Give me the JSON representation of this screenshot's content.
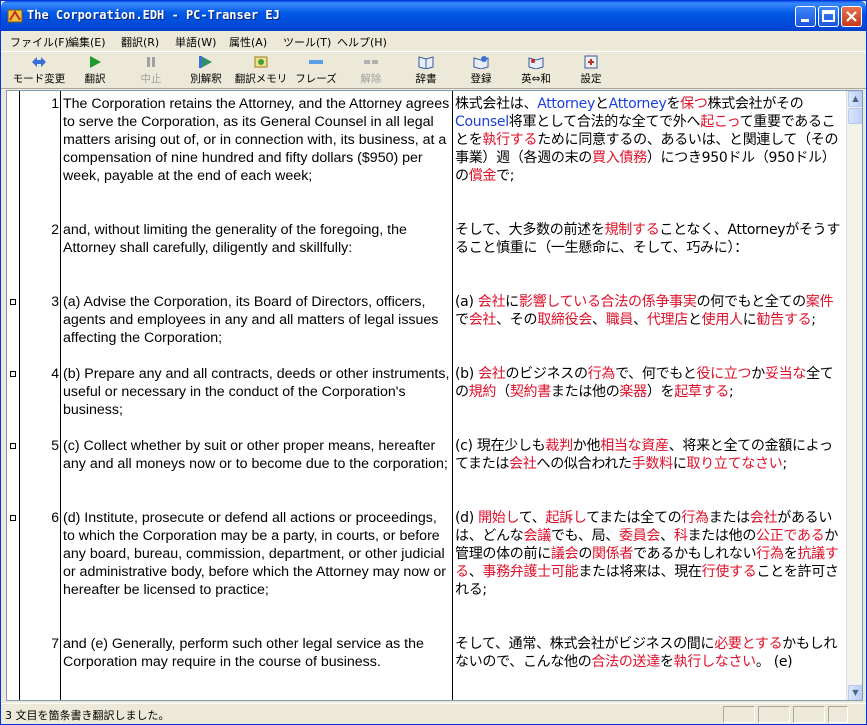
{
  "window": {
    "title": "The Corporation.EDH - PC-Transer EJ"
  },
  "menu": [
    "ファイル(F)",
    "編集(E)",
    "翻訳(R)",
    "単語(W)",
    "属性(A)",
    "ツール(T)",
    "ヘルプ(H)"
  ],
  "toolbar": [
    {
      "label": "モード変更",
      "icon": "mode-change-icon",
      "enabled": true
    },
    {
      "label": "翻訳",
      "icon": "play-icon",
      "enabled": true
    },
    {
      "label": "中止",
      "icon": "pause-icon",
      "enabled": false
    },
    {
      "label": "別解釈",
      "icon": "alternate-play-icon",
      "enabled": true
    },
    {
      "label": "翻訳メモリ",
      "icon": "translation-memory-icon",
      "enabled": true
    },
    {
      "label": "フレーズ",
      "icon": "phrase-icon",
      "enabled": true
    },
    {
      "label": "解除",
      "icon": "release-icon",
      "enabled": false
    },
    {
      "label": "辞書",
      "icon": "dictionary-icon",
      "enabled": true
    },
    {
      "label": "登録",
      "icon": "register-icon",
      "enabled": true
    },
    {
      "label": "英⇔和",
      "icon": "swap-direction-icon",
      "enabled": true
    },
    {
      "label": "設定",
      "icon": "settings-icon",
      "enabled": true
    }
  ],
  "colors": {
    "highlight_red": "#e0102a",
    "highlight_blue": "#1a3ee0",
    "titlebar_blue": "#0058e6"
  },
  "sentences": [
    {
      "num": "1",
      "marker": false,
      "en": "The Corporation retains the Attorney, and the Attorney agrees to serve the Corporation, as its General Counsel in all legal matters arising out of, or in connection with, its business, at a compensation of nine hundred and fifty dollars ($950) per week, payable at the end of each week;",
      "ja": [
        [
          "株式会社は、",
          ""
        ],
        [
          "Attorney",
          "b"
        ],
        [
          "と",
          ""
        ],
        [
          "Attorney",
          "b"
        ],
        [
          "を",
          ""
        ],
        [
          "保つ",
          "r"
        ],
        [
          "株式会社がそ",
          ""
        ],
        [
          "の",
          ""
        ],
        [
          "Counsel",
          "b"
        ],
        [
          "将軍として合法的な全てで外へ",
          ""
        ],
        [
          "起こっ",
          "r"
        ],
        [
          "て重要であることを",
          ""
        ],
        [
          "執行する",
          "r"
        ],
        [
          "ために同意するの、あるいは、と関連して（その事業）週（各週の末の",
          ""
        ],
        [
          "買入債務",
          "r"
        ],
        [
          "）につき950ドル（950ドル）の",
          ""
        ],
        [
          "償金",
          "r"
        ],
        [
          "で;",
          ""
        ]
      ]
    },
    {
      "num": "2",
      "marker": false,
      "en": "and, without limiting the generality of the foregoing, the Attorney shall carefully, diligently and skillfully:",
      "ja": [
        [
          "そして、大多数の前述を",
          ""
        ],
        [
          "規制する",
          "r"
        ],
        [
          "ことなく、Attorneyがそうすること慎重に（一生懸命に、そして、巧みに）：",
          ""
        ]
      ]
    },
    {
      "num": "3",
      "marker": true,
      "en": "(a) Advise the Corporation, its Board of Directors, officers, agents and employees in any and all matters of legal issues affecting the Corporation;",
      "ja": [
        [
          "(a) ",
          ""
        ],
        [
          "会社",
          "r"
        ],
        [
          "に",
          ""
        ],
        [
          "影響している合法の係争事実",
          "r"
        ],
        [
          "の何でもと全ての",
          ""
        ],
        [
          "案件",
          "r"
        ],
        [
          "で",
          ""
        ],
        [
          "会社",
          "r"
        ],
        [
          "、その",
          ""
        ],
        [
          "取締役会",
          "r"
        ],
        [
          "、",
          ""
        ],
        [
          "職員",
          "r"
        ],
        [
          "、",
          ""
        ],
        [
          "代理店",
          "r"
        ],
        [
          "と",
          ""
        ],
        [
          "使用人",
          "r"
        ],
        [
          "に",
          ""
        ],
        [
          "勧告する",
          "r"
        ],
        [
          ";",
          ""
        ]
      ]
    },
    {
      "num": "4",
      "marker": true,
      "en": "(b) Prepare any and all contracts, deeds or other instruments, useful or necessary in the conduct of the Corporation's business;",
      "ja": [
        [
          "(b) ",
          ""
        ],
        [
          "会社",
          "r"
        ],
        [
          "のビジネスの",
          ""
        ],
        [
          "行為",
          "r"
        ],
        [
          "で、何でもと",
          ""
        ],
        [
          "役に立つ",
          "r"
        ],
        [
          "か",
          ""
        ],
        [
          "妥当な",
          "r"
        ],
        [
          "全ての",
          ""
        ],
        [
          "規約",
          "r"
        ],
        [
          "（",
          ""
        ],
        [
          "契約書",
          "r"
        ],
        [
          "または他の",
          ""
        ],
        [
          "楽器",
          "r"
        ],
        [
          "）を",
          ""
        ],
        [
          "起草する",
          "r"
        ],
        [
          ";",
          ""
        ]
      ]
    },
    {
      "num": "5",
      "marker": true,
      "en": "(c) Collect whether by suit or other proper means, hereafter any and all moneys now or to become due to the corporation;",
      "ja": [
        [
          "(c) 現在少しも",
          ""
        ],
        [
          "裁判",
          "r"
        ],
        [
          "か他",
          ""
        ],
        [
          "相当な資産",
          "r"
        ],
        [
          "、将来と全ての金額によってまたは",
          ""
        ],
        [
          "会社",
          "r"
        ],
        [
          "への似合われた",
          ""
        ],
        [
          "手数料",
          "r"
        ],
        [
          "に",
          ""
        ],
        [
          "取り立てなさい",
          "r"
        ],
        [
          ";",
          ""
        ]
      ]
    },
    {
      "num": "6",
      "marker": true,
      "en": "(d) Institute, prosecute or defend all actions or proceedings, to which the Corporation may be a party, in courts, or before any board, bureau, commission, department, or other judicial or administrative body, before which the Attorney may now or hereafter be licensed to practice;",
      "ja": [
        [
          "(d) ",
          ""
        ],
        [
          "開始し",
          "r"
        ],
        [
          "て、",
          ""
        ],
        [
          "起訴し",
          "r"
        ],
        [
          "てまたは全ての",
          ""
        ],
        [
          "行為",
          "r"
        ],
        [
          "または",
          ""
        ],
        [
          "会社",
          "r"
        ],
        [
          "があるいは、どんな",
          ""
        ],
        [
          "会議",
          "r"
        ],
        [
          "でも、局、",
          ""
        ],
        [
          "委員会",
          "r"
        ],
        [
          "、",
          ""
        ],
        [
          "科",
          "r"
        ],
        [
          "または他の",
          ""
        ],
        [
          "公正である",
          "r"
        ],
        [
          "か管理の体の前に",
          ""
        ],
        [
          "議会",
          "r"
        ],
        [
          "の",
          ""
        ],
        [
          "関係者",
          "r"
        ],
        [
          "であるかもしれない",
          ""
        ],
        [
          "行為",
          "r"
        ],
        [
          "を",
          ""
        ],
        [
          "抗議する",
          "r"
        ],
        [
          "、",
          ""
        ],
        [
          "事務弁護士可能",
          "r"
        ],
        [
          "または将来は、現在",
          ""
        ],
        [
          "行使する",
          "r"
        ],
        [
          "ことを許可される;",
          ""
        ]
      ]
    },
    {
      "num": "7",
      "marker": false,
      "en": "and (e) Generally, perform such other legal service as the Corporation may require in the course of business.",
      "ja": [
        [
          "そして、通常、株式会社がビジネスの間に",
          ""
        ],
        [
          "必要とする",
          "r"
        ],
        [
          "かもしれないので、こんな他の",
          ""
        ],
        [
          "合法の送達",
          "r"
        ],
        [
          "を",
          ""
        ],
        [
          "執行しなさい",
          "r"
        ],
        [
          "。 (e)",
          ""
        ]
      ]
    }
  ],
  "status": {
    "message": "3 文目を箇条書き翻訳しました。"
  }
}
